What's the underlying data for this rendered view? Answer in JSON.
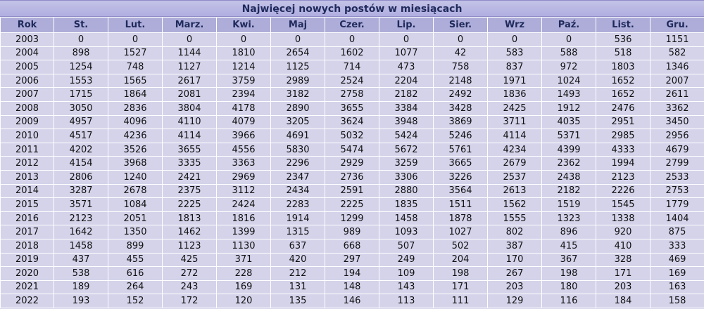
{
  "title": "Najwięcej nowych postów w miesiącach",
  "headers": [
    "Rok",
    "St.",
    "Lut.",
    "Marz.",
    "Kwi.",
    "Maj",
    "Czer.",
    "Lip.",
    "Sier.",
    "Wrz",
    "Paź.",
    "List.",
    "Gru."
  ],
  "rows": [
    [
      "2003",
      "0",
      "0",
      "0",
      "0",
      "0",
      "0",
      "0",
      "0",
      "0",
      "0",
      "536",
      "1151"
    ],
    [
      "2004",
      "898",
      "1527",
      "1144",
      "1810",
      "2654",
      "1602",
      "1077",
      "42",
      "583",
      "588",
      "518",
      "582"
    ],
    [
      "2005",
      "1254",
      "748",
      "1127",
      "1214",
      "1125",
      "714",
      "473",
      "758",
      "837",
      "972",
      "1803",
      "1346"
    ],
    [
      "2006",
      "1553",
      "1565",
      "2617",
      "3759",
      "2989",
      "2524",
      "2204",
      "2148",
      "1971",
      "1024",
      "1652",
      "2007"
    ],
    [
      "2007",
      "1715",
      "1864",
      "2081",
      "2394",
      "3182",
      "2758",
      "2182",
      "2492",
      "1836",
      "1493",
      "1652",
      "2611"
    ],
    [
      "2008",
      "3050",
      "2836",
      "3804",
      "4178",
      "2890",
      "3655",
      "3384",
      "3428",
      "2425",
      "1912",
      "2476",
      "3362"
    ],
    [
      "2009",
      "4957",
      "4096",
      "4110",
      "4079",
      "3205",
      "3624",
      "3948",
      "3869",
      "3711",
      "4035",
      "2951",
      "3450"
    ],
    [
      "2010",
      "4517",
      "4236",
      "4114",
      "3966",
      "4691",
      "5032",
      "5424",
      "5246",
      "4114",
      "5371",
      "2985",
      "2956"
    ],
    [
      "2011",
      "4202",
      "3526",
      "3655",
      "4556",
      "5830",
      "5474",
      "5672",
      "5761",
      "4234",
      "4399",
      "4333",
      "4679"
    ],
    [
      "2012",
      "4154",
      "3968",
      "3335",
      "3363",
      "2296",
      "2929",
      "3259",
      "3665",
      "2679",
      "2362",
      "1994",
      "2799"
    ],
    [
      "2013",
      "2806",
      "1240",
      "2421",
      "2969",
      "2347",
      "2736",
      "3306",
      "3226",
      "2537",
      "2438",
      "2123",
      "2533"
    ],
    [
      "2014",
      "3287",
      "2678",
      "2375",
      "3112",
      "2434",
      "2591",
      "2880",
      "3564",
      "2613",
      "2182",
      "2226",
      "2753"
    ],
    [
      "2015",
      "3571",
      "1084",
      "2225",
      "2424",
      "2283",
      "2225",
      "1835",
      "1511",
      "1562",
      "1519",
      "1545",
      "1779"
    ],
    [
      "2016",
      "2123",
      "2051",
      "1813",
      "1816",
      "1914",
      "1299",
      "1458",
      "1878",
      "1555",
      "1323",
      "1338",
      "1404"
    ],
    [
      "2017",
      "1642",
      "1350",
      "1462",
      "1399",
      "1315",
      "989",
      "1093",
      "1027",
      "802",
      "896",
      "920",
      "875"
    ],
    [
      "2018",
      "1458",
      "899",
      "1123",
      "1130",
      "637",
      "668",
      "507",
      "502",
      "387",
      "415",
      "410",
      "333"
    ],
    [
      "2019",
      "437",
      "455",
      "425",
      "371",
      "420",
      "297",
      "249",
      "204",
      "170",
      "367",
      "328",
      "469"
    ],
    [
      "2020",
      "538",
      "616",
      "272",
      "228",
      "212",
      "194",
      "109",
      "198",
      "267",
      "198",
      "171",
      "169"
    ],
    [
      "2021",
      "189",
      "264",
      "243",
      "169",
      "131",
      "148",
      "143",
      "171",
      "203",
      "180",
      "203",
      "163"
    ],
    [
      "2022",
      "193",
      "152",
      "172",
      "120",
      "135",
      "146",
      "113",
      "111",
      "129",
      "116",
      "184",
      "158"
    ]
  ]
}
